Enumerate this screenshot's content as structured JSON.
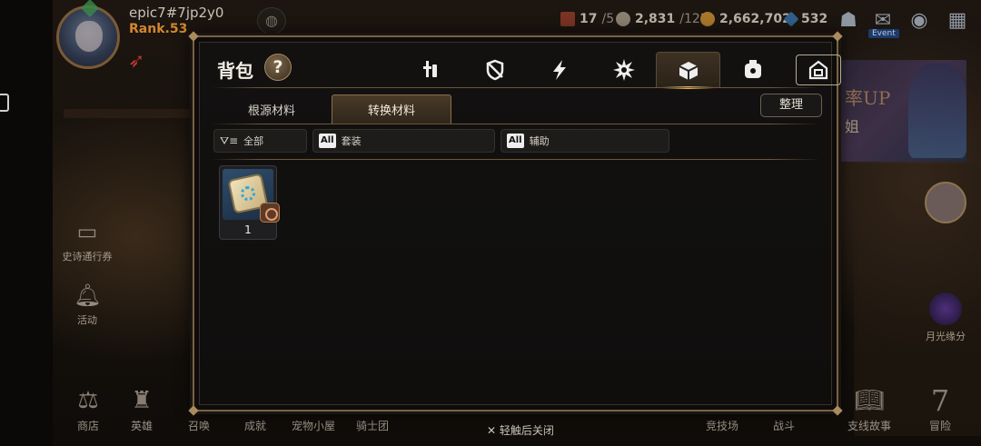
{
  "player": {
    "nickname": "epic7#7jp2y0",
    "rank": "Rank.53"
  },
  "resources": {
    "stamina_value": "17",
    "stamina_max": "/5",
    "leif_value": "2,831",
    "leif_max": "/122",
    "gold": "2,662,702",
    "crystals": "532"
  },
  "hud": {
    "event_tag": "Event"
  },
  "side_menu": {
    "pass_label": "史诗通行券",
    "activity_label": "活动"
  },
  "banner": {
    "text": "率UP",
    "sub": "姐"
  },
  "moon_label": "月光缘分",
  "bottom_nav": [
    {
      "label": "商店"
    },
    {
      "label": "英雄"
    },
    {
      "label": "召唤"
    },
    {
      "label": "成就"
    },
    {
      "label": "宠物小屋"
    },
    {
      "label": "骑士团"
    },
    {
      "label": "竞技场"
    },
    {
      "label": "战斗"
    },
    {
      "label": "支线故事"
    },
    {
      "label": "冒险"
    }
  ],
  "close_hint": "轻触后关闭",
  "bag": {
    "title": "背包",
    "help": "?",
    "sub_tabs": [
      "根源材料",
      "转换材料"
    ],
    "sort_label": "整理",
    "filters": {
      "all_label": "全部",
      "set_badge": "All",
      "set_label": "套装",
      "sub_badge": "All",
      "sub_label": "辅助"
    },
    "items": [
      {
        "count": "1"
      }
    ]
  },
  "colors": {
    "frame": "#7a6245",
    "accent": "#e8b860",
    "rank": "#d3862f"
  }
}
